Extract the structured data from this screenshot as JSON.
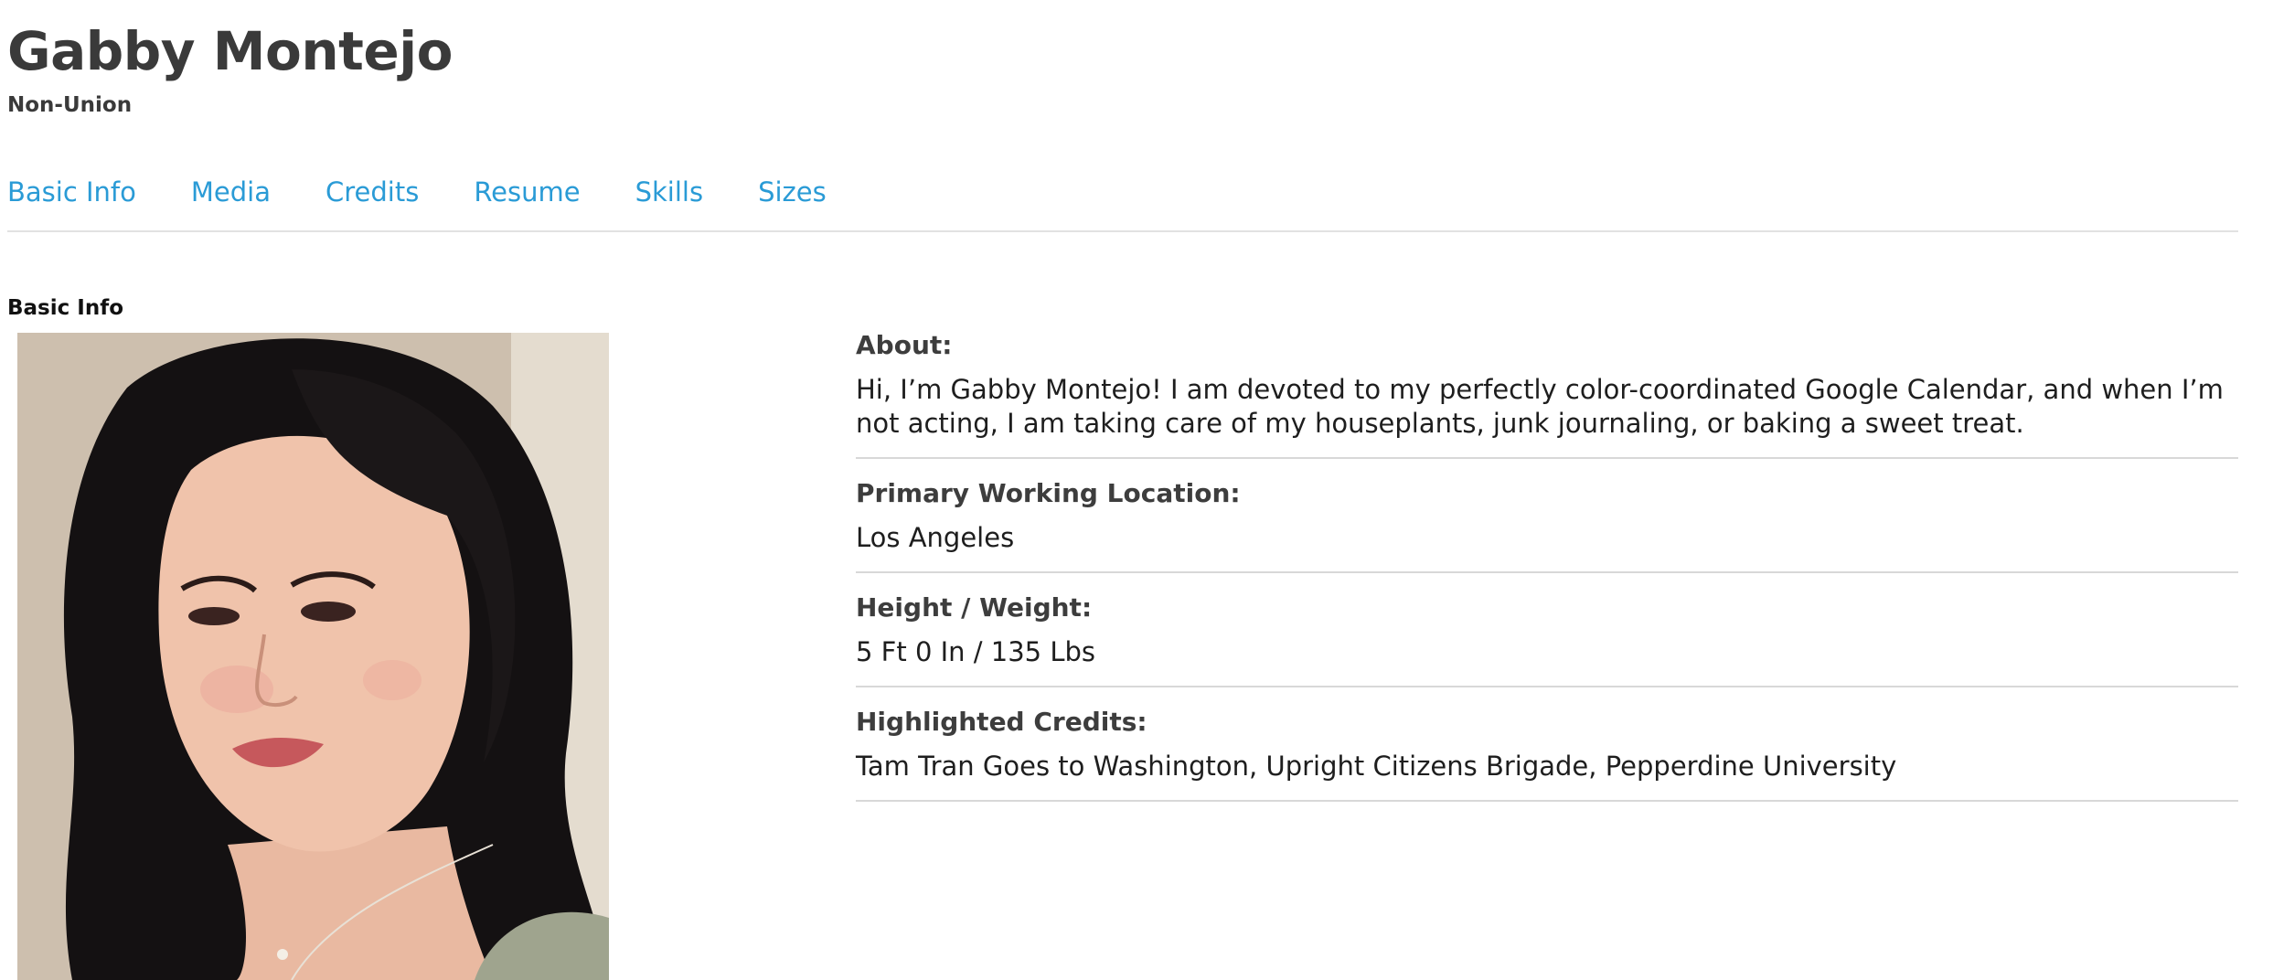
{
  "profile": {
    "name": "Gabby Montejo",
    "union_status": "Non-Union"
  },
  "nav": {
    "tabs": [
      "Basic Info",
      "Media",
      "Credits",
      "Resume",
      "Skills",
      "Sizes"
    ]
  },
  "section": {
    "title": "Basic Info"
  },
  "photo": {
    "alt": "Headshot of Gabby Montejo"
  },
  "fields": [
    {
      "label": "About:",
      "value": "Hi, I’m Gabby Montejo! I am devoted to my perfectly color-coordinated Google Calendar, and when I’m not acting, I am taking care of my houseplants, junk journaling, or baking a sweet treat."
    },
    {
      "label": "Primary Working Location:",
      "value": "Los Angeles"
    },
    {
      "label": "Height / Weight:",
      "value": "5 Ft 0 In / 135 Lbs"
    },
    {
      "label": "Highlighted Credits:",
      "value": "Tam Tran Goes to Washington, Upright Citizens Brigade, Pepperdine University"
    }
  ],
  "colors": {
    "link": "#2a9bd6",
    "heading": "#3a3a3a",
    "divider": "#d8d8d8"
  }
}
